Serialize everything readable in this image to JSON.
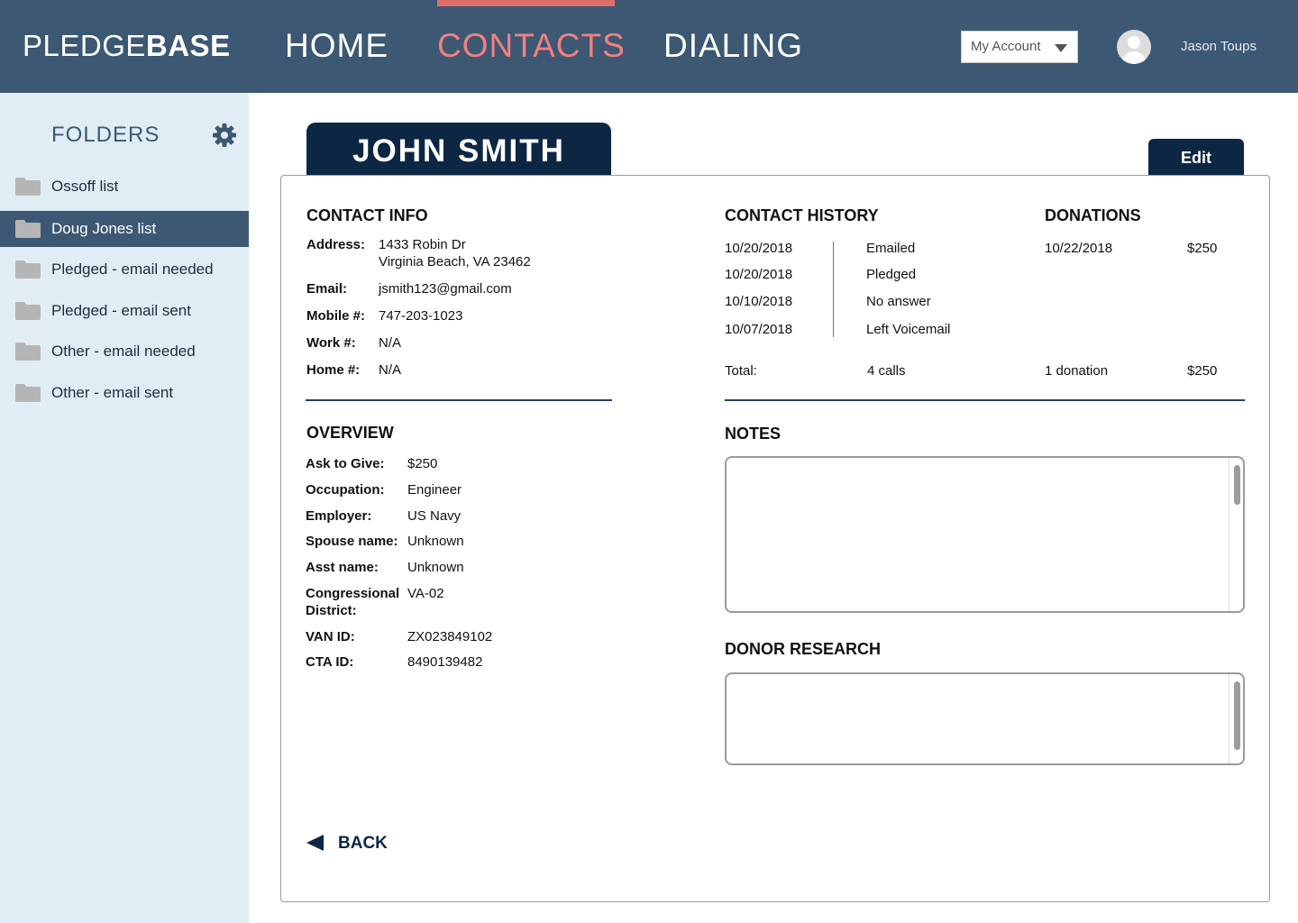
{
  "header": {
    "logo_light": "PLEDGE",
    "logo_bold": "BASE",
    "nav": {
      "home": "HOME",
      "contacts": "CONTACTS",
      "dialing": "DIALING"
    },
    "account_select": "My Account",
    "user_name": "Jason Toups"
  },
  "sidebar": {
    "title": "FOLDERS",
    "items": [
      {
        "label": "Ossoff list"
      },
      {
        "label": "Doug Jones list"
      },
      {
        "label": "Pledged - email needed"
      },
      {
        "label": "Pledged - email sent"
      },
      {
        "label": "Other - email needed"
      },
      {
        "label": "Other - email sent"
      }
    ],
    "active_index": 1
  },
  "contact": {
    "name": "JOHN SMITH",
    "edit_label": "Edit",
    "contact_info": {
      "title": "CONTACT INFO",
      "address_label": "Address:",
      "address_line1": "1433 Robin Dr",
      "address_line2": "Virginia Beach, VA 23462",
      "email_label": "Email:",
      "email": "jsmith123@gmail.com",
      "mobile_label": "Mobile #:",
      "mobile": "747-203-1023",
      "work_label": "Work #:",
      "work": "N/A",
      "home_label": "Home #:",
      "home": "N/A"
    },
    "history": {
      "title": "CONTACT HISTORY",
      "rows": [
        {
          "date": "10/20/2018",
          "action": "Emailed"
        },
        {
          "date": "10/20/2018",
          "action": "Pledged"
        },
        {
          "date": "10/10/2018",
          "action": "No answer"
        },
        {
          "date": "10/07/2018",
          "action": "Left Voicemail"
        }
      ],
      "total_label": "Total:",
      "total_calls": "4 calls"
    },
    "donations": {
      "title": "DONATIONS",
      "rows": [
        {
          "date": "10/22/2018",
          "amount": "$250"
        }
      ],
      "total_count": "1 donation",
      "total_amount": "$250"
    },
    "overview": {
      "title": "OVERVIEW",
      "ask_label": "Ask to Give:",
      "ask": "$250",
      "occupation_label": "Occupation:",
      "occupation": "Engineer",
      "employer_label": "Employer:",
      "employer": "US Navy",
      "spouse_label": "Spouse name:",
      "spouse": "Unknown",
      "asst_label": "Asst name:",
      "asst": "Unknown",
      "district_label_1": "Congressional",
      "district_label_2": "District:",
      "district": "VA-02",
      "van_label": "VAN ID:",
      "van": "ZX023849102",
      "cta_label": "CTA ID:",
      "cta": "8490139482"
    },
    "notes_title": "NOTES",
    "notes_value": "",
    "research_title": "DONOR RESEARCH",
    "research_value": "",
    "back_label": "BACK"
  },
  "colors": {
    "header_bg": "#3c5873",
    "accent": "#f08080",
    "sidebar_bg": "#e0edf5",
    "dark_navy": "#0c2744"
  },
  "icons": [
    "gear-icon",
    "folder-icon",
    "avatar-icon",
    "chevron-down-icon",
    "back-arrow-icon"
  ]
}
